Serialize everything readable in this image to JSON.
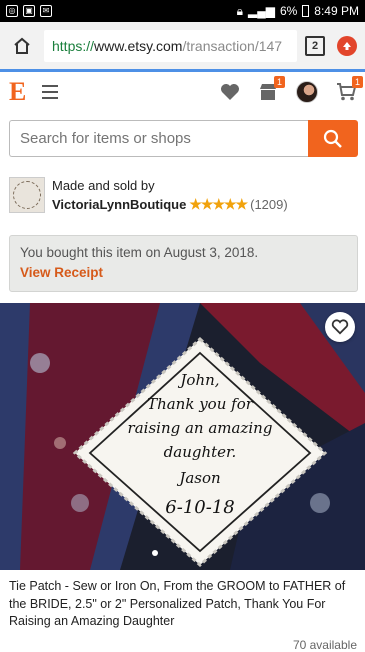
{
  "status_bar": {
    "icons_left": [
      "target-icon",
      "image-icon",
      "mail-icon"
    ],
    "battery": "6%",
    "time": "8:49 PM"
  },
  "browser": {
    "url_scheme": "https://",
    "url_host": "www.etsy.com",
    "url_path": "/transaction/147",
    "tab_count": "2"
  },
  "header": {
    "logo": "E",
    "cart_badge": "1",
    "shop_badge": "1"
  },
  "search": {
    "placeholder": "Search for items or shops"
  },
  "shop": {
    "made_by": "Made and sold by",
    "name": "VictoriaLynnBoutique",
    "stars": "★★★★★",
    "reviews": "(1209)"
  },
  "purchase": {
    "text": "You bought this item on August 3, 2018.",
    "link": "View Receipt"
  },
  "product": {
    "patch_lines": [
      "John,",
      "Thank you for",
      "raising an amazing",
      "daughter.",
      "Jason",
      "6-10-18"
    ],
    "title": "Tie Patch - Sew or Iron On, From the GROOM to FATHER of the BRIDE, 2.5\" or 2\" Personalized Patch, Thank You For Raising an Amazing Daughter",
    "availability": "70 available"
  },
  "colors": {
    "accent": "#f1641e",
    "link": "#d65a1a",
    "star": "#f1a20c"
  }
}
